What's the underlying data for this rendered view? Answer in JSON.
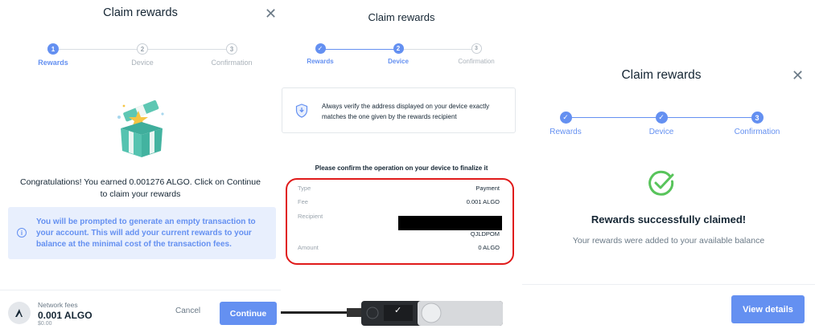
{
  "panel1": {
    "title": "Claim rewards",
    "close_icon": "close-icon",
    "steps": [
      {
        "num": "1",
        "label": "Rewards",
        "state": "active"
      },
      {
        "num": "2",
        "label": "Device",
        "state": "todo"
      },
      {
        "num": "3",
        "label": "Confirmation",
        "state": "todo"
      }
    ],
    "illustration_icon": "gift-box-illustration",
    "congrats": "Congratulations! You earned 0.001276 ALGO. Click on Continue to claim your rewards",
    "info_icon": "info-icon",
    "info_symbol": "i",
    "info_text": "You will be prompted to generate an empty transaction to your account. This will add your current rewards to your balance at the minimal cost of the transaction fees.",
    "footer": {
      "avatar_letter": "A",
      "fees_label": "Network fees",
      "fees_value": "0.001 ALGO",
      "fees_usd": "$0.00",
      "cancel_label": "Cancel",
      "continue_label": "Continue"
    }
  },
  "panel2": {
    "title": "Claim rewards",
    "steps": [
      {
        "num": "✓",
        "label": "Rewards",
        "state": "done"
      },
      {
        "num": "2",
        "label": "Device",
        "state": "active"
      },
      {
        "num": "3",
        "label": "Confirmation",
        "state": "todo"
      }
    ],
    "warning_icon": "shield-icon",
    "warning_text": "Always verify the address displayed on your device exactly matches the one given by the rewards recipient",
    "confirm_title": "Please confirm the operation on your device to finalize it",
    "rows": [
      {
        "key": "Type",
        "value": "Payment"
      },
      {
        "key": "Fee",
        "value": "0.001 ALGO"
      },
      {
        "key": "Recipient",
        "value": "QJLDPOM"
      },
      {
        "key": "Amount",
        "value": "0 ALGO"
      }
    ],
    "device_icon": "hardware-wallet-device",
    "device_check": "✓"
  },
  "panel3": {
    "title": "Claim rewards",
    "close_icon": "close-icon",
    "steps": [
      {
        "num": "✓",
        "label": "Rewards",
        "state": "done"
      },
      {
        "num": "✓",
        "label": "Device",
        "state": "done"
      },
      {
        "num": "3",
        "label": "Confirmation",
        "state": "active"
      }
    ],
    "success_icon": "success-check-icon",
    "success_title": "Rewards successfully claimed!",
    "success_sub": "Your rewards were added to your available balance",
    "view_details_label": "View details"
  },
  "colors": {
    "accent": "#6490f1",
    "success": "#58c45b",
    "highlight": "#e01a1a",
    "info_bg": "#e8effd"
  }
}
